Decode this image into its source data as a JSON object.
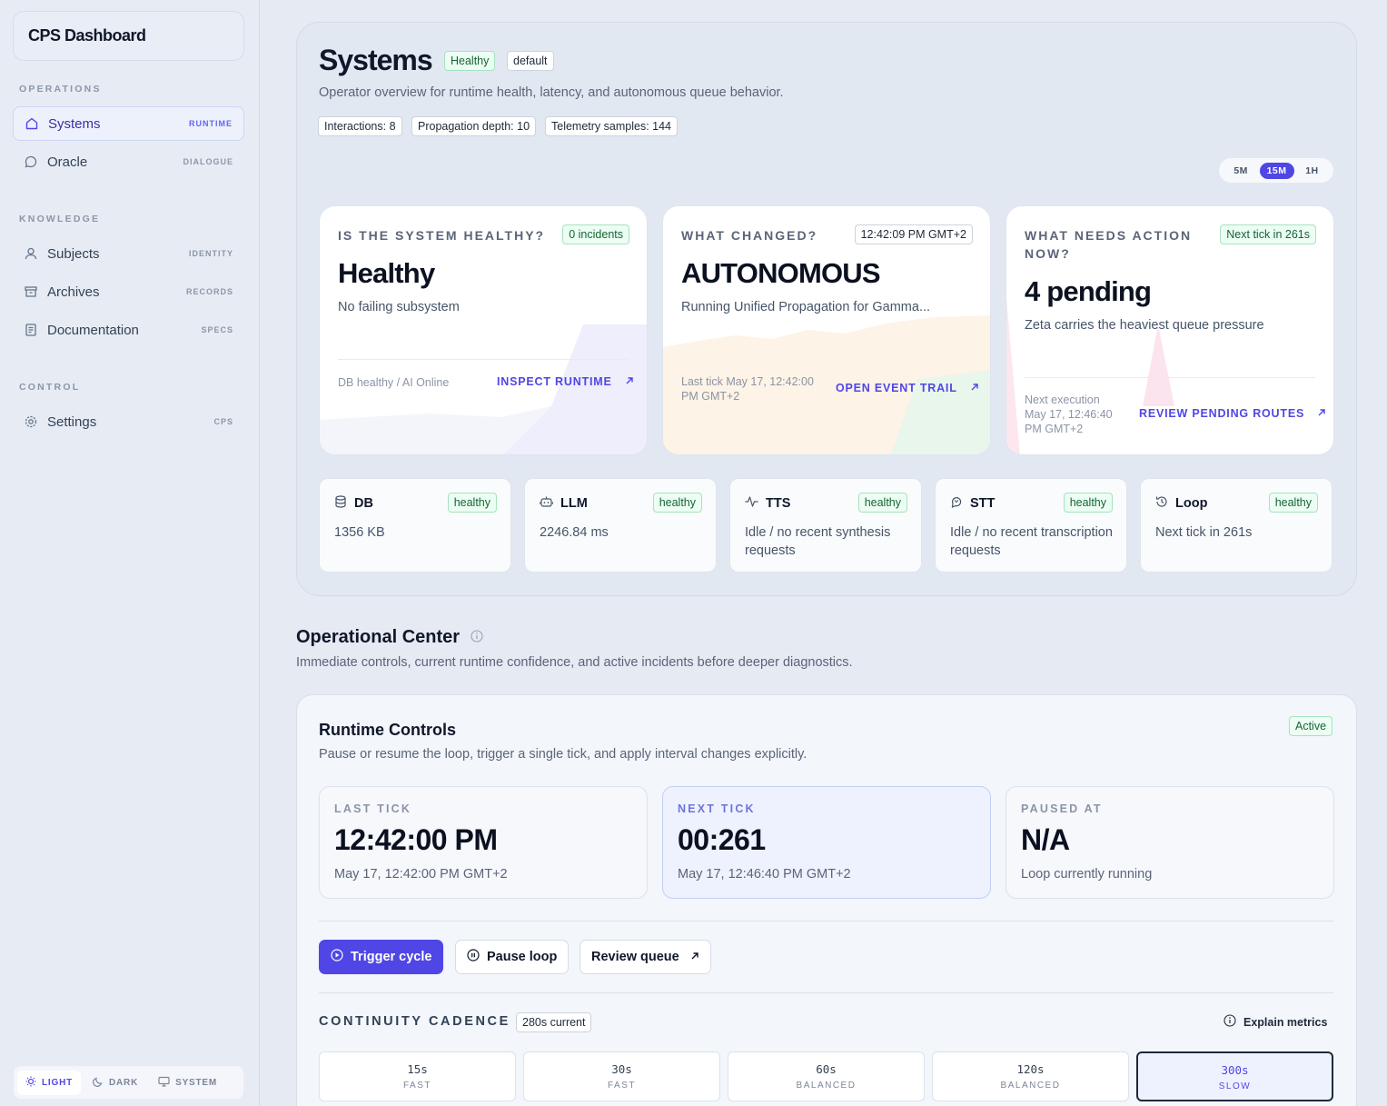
{
  "app": {
    "brand": "CPS Dashboard"
  },
  "sidebar": {
    "groups": [
      "OPERATIONS",
      "KNOWLEDGE",
      "CONTROL"
    ],
    "items": [
      {
        "label": "Systems",
        "tag": "RUNTIME"
      },
      {
        "label": "Oracle",
        "tag": "DIALOGUE"
      },
      {
        "label": "Subjects",
        "tag": "IDENTITY"
      },
      {
        "label": "Archives",
        "tag": "RECORDS"
      },
      {
        "label": "Documentation",
        "tag": "SPECS"
      },
      {
        "label": "Settings",
        "tag": "CPS"
      }
    ],
    "theme": [
      "LIGHT",
      "DARK",
      "SYSTEM"
    ]
  },
  "header": {
    "title": "Systems",
    "status": "Healthy",
    "profile": "default",
    "subtitle": "Operator overview for runtime health, latency, and autonomous queue behavior.",
    "stats": [
      "Interactions: 8",
      "Propagation depth: 10",
      "Telemetry samples: 144"
    ],
    "ranges": [
      "5M",
      "15M",
      "1H"
    ],
    "range_selected": "15M"
  },
  "cards": [
    {
      "question": "IS THE SYSTEM HEALTHY?",
      "badge": "0 incidents",
      "value": "Healthy",
      "desc": "No failing subsystem",
      "foot": "DB healthy / AI Online",
      "link": "INSPECT RUNTIME"
    },
    {
      "question": "WHAT CHANGED?",
      "badge": "12:42:09 PM GMT+2",
      "value": "AUTONOMOUS",
      "desc": "Running Unified Propagation for Gamma...",
      "foot1": "Last tick May 17, 12:42:00",
      "foot2": "PM GMT+2",
      "link": "OPEN EVENT TRAIL"
    },
    {
      "question1": "WHAT NEEDS ACTION",
      "question2": "NOW?",
      "badge": "Next tick in 261s",
      "value": "4 pending",
      "desc": "Zeta carries the heaviest queue pressure",
      "foot1": "Next execution",
      "foot2": "May 17, 12:46:40",
      "foot3": "PM GMT+2",
      "link": "REVIEW PENDING ROUTES"
    }
  ],
  "subsystems": [
    {
      "name": "DB",
      "status": "healthy",
      "value": "1356 KB",
      "icon": "database-icon"
    },
    {
      "name": "LLM",
      "status": "healthy",
      "value": "2246.84 ms",
      "icon": "bot-icon"
    },
    {
      "name": "TTS",
      "status": "healthy",
      "value": "Idle / no recent synthesis requests",
      "icon": "activity-icon"
    },
    {
      "name": "STT",
      "status": "healthy",
      "value": "Idle / no recent transcription requests",
      "icon": "speech-icon"
    },
    {
      "name": "Loop",
      "status": "healthy",
      "value": "Next tick in 261s",
      "icon": "history-icon"
    }
  ],
  "operational_center": {
    "title": "Operational Center",
    "subtitle": "Immediate controls, current runtime confidence, and active incidents before deeper diagnostics."
  },
  "runtime_controls": {
    "title": "Runtime Controls",
    "subtitle": "Pause or resume the loop, trigger a single tick, and apply interval changes explicitly.",
    "badge": "Active",
    "ticks": [
      {
        "label": "LAST TICK",
        "value": "12:42:00 PM",
        "sub": "May 17, 12:42:00 PM GMT+2"
      },
      {
        "label": "NEXT TICK",
        "value": "00:261",
        "sub": "May 17, 12:46:40 PM GMT+2"
      },
      {
        "label": "PAUSED AT",
        "value": "N/A",
        "sub": "Loop currently running"
      }
    ],
    "buttons": {
      "trigger": "Trigger cycle",
      "pause": "Pause loop",
      "review": "Review queue"
    },
    "cadence_title": "CONTINUITY CADENCE",
    "cadence_current": "280s current",
    "explain": "Explain metrics",
    "cadences": [
      {
        "value": "15s",
        "label": "FAST"
      },
      {
        "value": "30s",
        "label": "FAST"
      },
      {
        "value": "60s",
        "label": "BALANCED"
      },
      {
        "value": "120s",
        "label": "BALANCED"
      },
      {
        "value": "300s",
        "label": "SLOW"
      }
    ],
    "cadence_selected": "300s"
  },
  "colors": {
    "accent": "#4f46e5",
    "healthy": "#166534",
    "healthy_bg": "#ecfdf3"
  }
}
